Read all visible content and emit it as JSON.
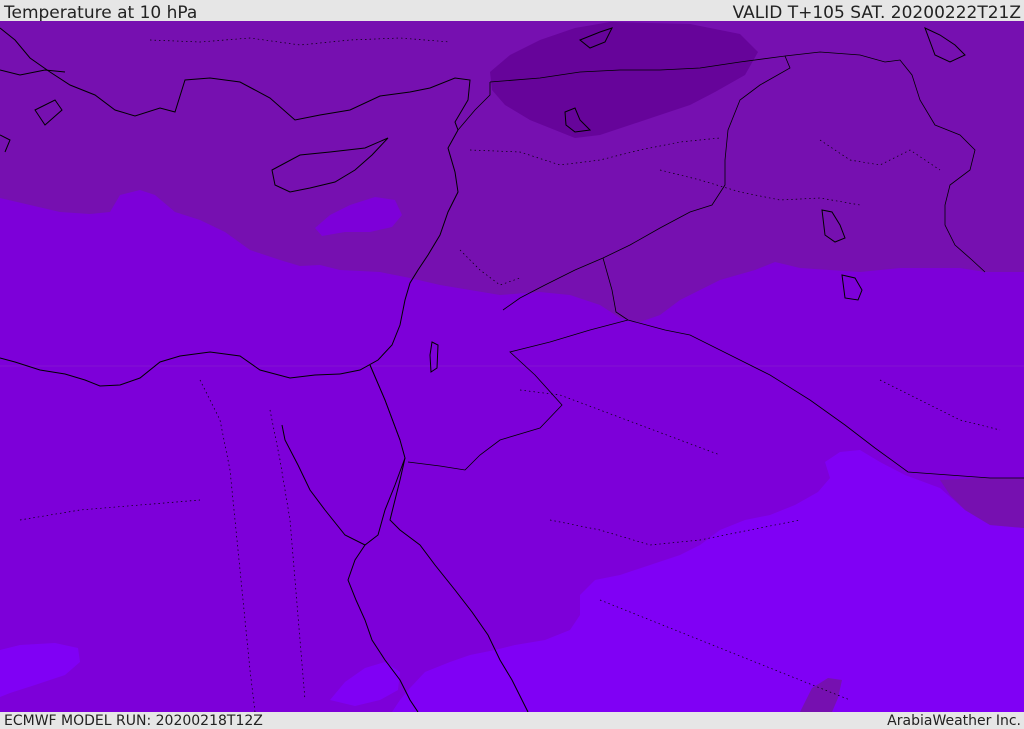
{
  "header": {
    "title": "Temperature at 10 hPa",
    "valid_time": "VALID T+105 SAT. 20200222T21Z"
  },
  "footer": {
    "model_run": "ECMWF MODEL RUN: 20200218T12Z",
    "credit": "ArabiaWeather Inc."
  },
  "map": {
    "variable": "Temperature",
    "level": "10 hPa",
    "shading_colors": {
      "darkest": "#66049a",
      "dark": "#7610b0",
      "medium": "#7d00d9",
      "light": "#8000f5",
      "lightest": "#8400ff"
    },
    "border_color": "#000000"
  }
}
